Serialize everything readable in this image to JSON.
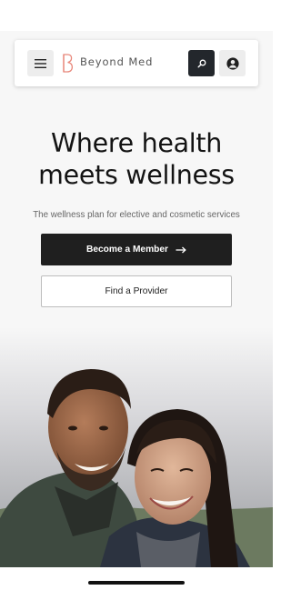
{
  "brand": {
    "name": "Beyond Med",
    "accent_color": "#e8877a"
  },
  "header": {
    "menu_icon": "hamburger-icon",
    "search_icon": "search-icon",
    "account_icon": "account-icon"
  },
  "hero": {
    "title_line1": "Where health",
    "title_line2": "meets wellness",
    "subtitle": "The wellness plan for elective and cosmetic services",
    "primary_cta": "Become a Member",
    "primary_cta_icon": "arrow-right-icon",
    "secondary_cta": "Find a Provider"
  },
  "colors": {
    "primary_button": "#1f1f1f",
    "search_button": "#23272c",
    "background": "#f7f7f7"
  }
}
